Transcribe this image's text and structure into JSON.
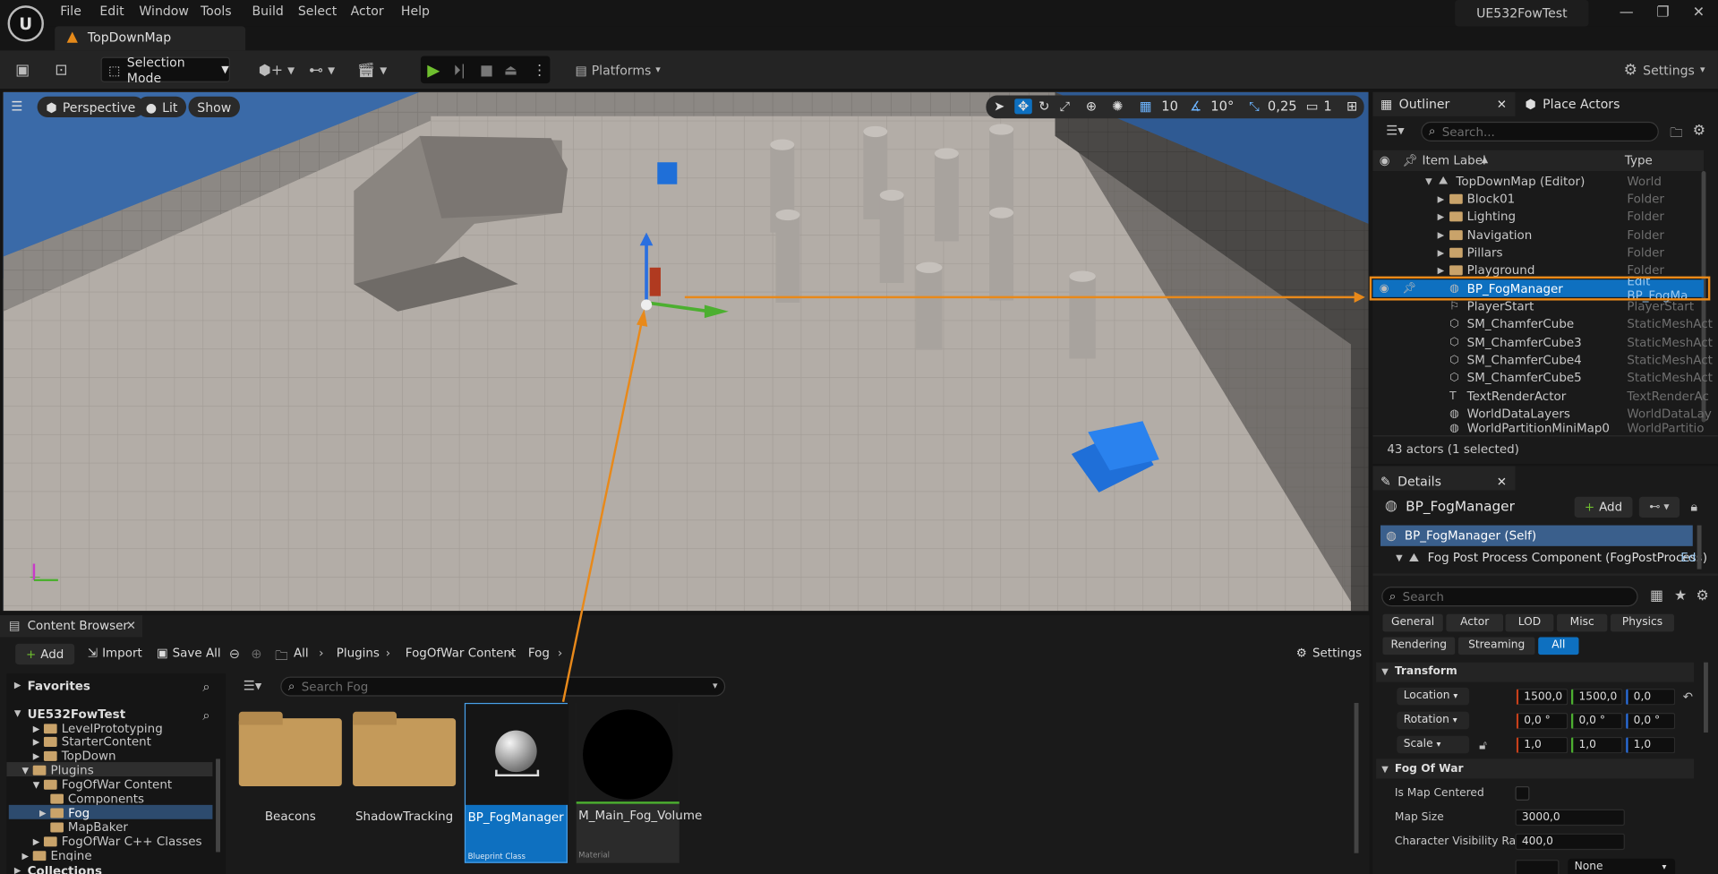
{
  "menu": {
    "items": [
      "File",
      "Edit",
      "Window",
      "Tools",
      "Build",
      "Select",
      "Actor",
      "Help"
    ],
    "project_title": "UE532FowTest"
  },
  "document_tab": {
    "label": "TopDownMap"
  },
  "toolbar": {
    "selection_mode": "Selection Mode",
    "platforms": "Platforms",
    "settings": "Settings"
  },
  "viewport": {
    "perspective": "Perspective",
    "lit": "Lit",
    "show": "Show",
    "grid_snap": "10",
    "rotation_snap": "10°",
    "scale_snap": "0,25",
    "camera_speed": "1"
  },
  "outliner": {
    "tab": "Outliner",
    "place_actors_tab": "Place Actors",
    "search_placeholder": "Search...",
    "col_label": "Item Label",
    "col_type": "Type",
    "rows": [
      {
        "label": "TopDownMap (Editor)",
        "type": "World"
      },
      {
        "label": "Block01",
        "type": "Folder"
      },
      {
        "label": "Lighting",
        "type": "Folder"
      },
      {
        "label": "Navigation",
        "type": "Folder"
      },
      {
        "label": "Pillars",
        "type": "Folder"
      },
      {
        "label": "Playground",
        "type": "Folder"
      },
      {
        "label": "BP_FogManager",
        "type": "Edit BP_FogMa"
      },
      {
        "label": "PlayerStart",
        "type": "PlayerStart"
      },
      {
        "label": "SM_ChamferCube",
        "type": "StaticMeshAct"
      },
      {
        "label": "SM_ChamferCube3",
        "type": "StaticMeshAct"
      },
      {
        "label": "SM_ChamferCube4",
        "type": "StaticMeshAct"
      },
      {
        "label": "SM_ChamferCube5",
        "type": "StaticMeshAct"
      },
      {
        "label": "TextRenderActor",
        "type": "TextRenderAc"
      },
      {
        "label": "WorldDataLayers",
        "type": "WorldDataLay"
      },
      {
        "label": "WorldPartitionMiniMap0",
        "type": "WorldPartition"
      }
    ],
    "status": "43 actors (1 selected)"
  },
  "details": {
    "tab": "Details",
    "actor_name": "BP_FogManager",
    "add_label": "Add",
    "components": [
      "BP_FogManager (Self)",
      "Fog Post Process Component (FogPostProcess)"
    ],
    "component_edit": "Ed",
    "search_placeholder": "Search",
    "filters_row1": [
      "General",
      "Actor",
      "LOD",
      "Misc",
      "Physics"
    ],
    "filters_row2": [
      "Rendering",
      "Streaming",
      "All"
    ],
    "transform": {
      "title": "Transform",
      "location": {
        "label": "Location",
        "x": "1500,0",
        "y": "1500,0",
        "z": "0,0"
      },
      "rotation": {
        "label": "Rotation",
        "x": "0,0 °",
        "y": "0,0 °",
        "z": "0,0 °"
      },
      "scale": {
        "label": "Scale",
        "x": "1,0",
        "y": "1,0",
        "z": "1,0"
      }
    },
    "fog_of_war": {
      "title": "Fog Of War",
      "is_map_centered_label": "Is Map Centered",
      "map_size_label": "Map Size",
      "map_size": "3000,0",
      "char_vis_label": "Character Visibility Ra...",
      "char_vis": "400,0",
      "none_option": "None"
    }
  },
  "content_browser": {
    "tab": "Content Browser",
    "add": "Add",
    "import": "Import",
    "save_all": "Save All",
    "breadcrumb": [
      "All",
      "Plugins",
      "FogOfWar Content",
      "Fog"
    ],
    "settings": "Settings",
    "favorites": "Favorites",
    "project": "UE532FowTest",
    "search_placeholder": "Search Fog",
    "tree": [
      {
        "label": "LevelPrototyping",
        "indent": 2
      },
      {
        "label": "StarterContent",
        "indent": 2
      },
      {
        "label": "TopDown",
        "indent": 2
      },
      {
        "label": "Plugins",
        "indent": 1
      },
      {
        "label": "FogOfWar Content",
        "indent": 2
      },
      {
        "label": "Components",
        "indent": 3
      },
      {
        "label": "Fog",
        "indent": 3
      },
      {
        "label": "MapBaker",
        "indent": 3
      },
      {
        "label": "FogOfWar C++ Classes",
        "indent": 2
      },
      {
        "label": "Engine",
        "indent": 1
      }
    ],
    "collections": "Collections",
    "assets": [
      {
        "name": "Beacons",
        "kind": "folder"
      },
      {
        "name": "ShadowTracking",
        "kind": "folder"
      },
      {
        "name": "BP_FogManager",
        "kind": "blueprint",
        "sub": "Blueprint Class"
      },
      {
        "name": "M_Main_Fog_Volume",
        "kind": "material",
        "sub": "Material"
      }
    ]
  },
  "colors": {
    "accent_orange": "#e8891a",
    "selection_blue": "#0e70c0",
    "panel_bg": "#1a1a1a"
  }
}
